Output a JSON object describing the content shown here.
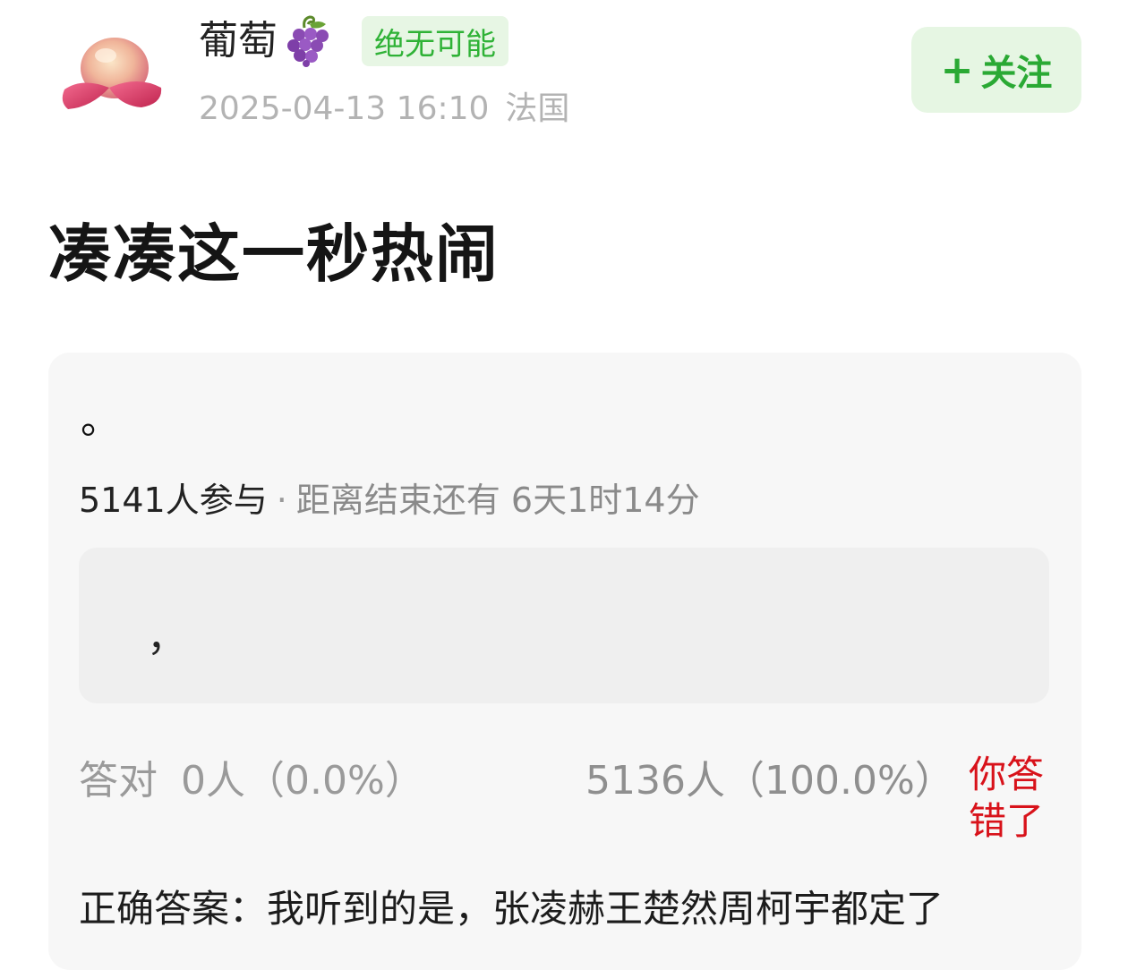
{
  "user": {
    "name": "葡萄",
    "name_emoji_icon": "grape-icon",
    "badge": "绝无可能",
    "time": "2025-04-13 16:10",
    "location": "法国",
    "follow_plus": "+",
    "follow_label": "关注"
  },
  "post": {
    "title": "凑凑这一秒热闹"
  },
  "quiz": {
    "question": "。",
    "participants": "5141人参与",
    "separator": "·",
    "remaining": "距离结束还有 6天1时14分",
    "option_text": "，",
    "correct_label": "答对",
    "correct_value": "0人（0.0%）",
    "wrong_value": "5136人（100.0%）",
    "your_result": "你答错了",
    "answer": "正确答案：我听到的是，张凌赫王楚然周柯宇都定了"
  },
  "colors": {
    "accent_green": "#2aa934",
    "badge_bg": "#e7f6e4",
    "wrong_red": "#d8121a",
    "card_bg": "#f7f7f7"
  }
}
